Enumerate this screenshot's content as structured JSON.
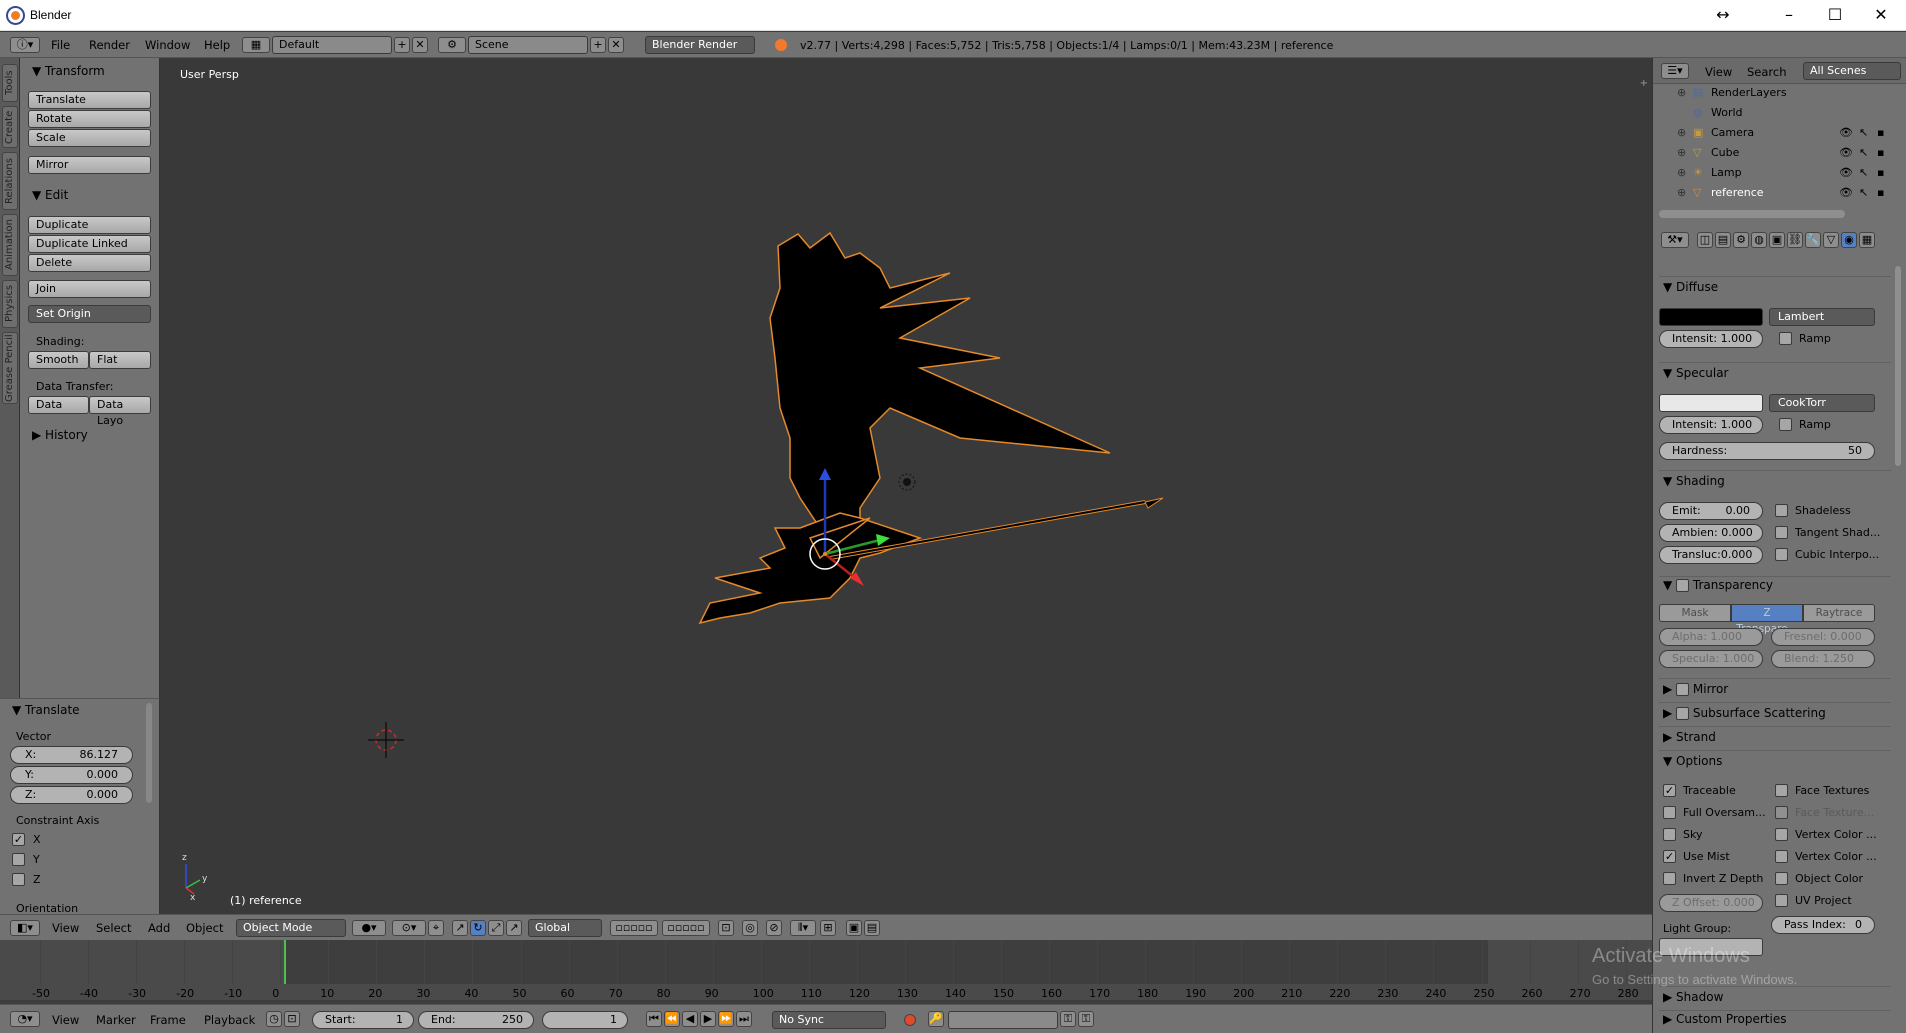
{
  "window": {
    "title": "Blender"
  },
  "menu": {
    "file": "File",
    "render": "Render",
    "window": "Window",
    "help": "Help"
  },
  "screen_layout": "Default",
  "scene": "Scene",
  "engine": "Blender Render",
  "stats": "v2.77 | Verts:4,298 | Faces:5,752 | Tris:5,758 | Objects:1/4 | Lamps:0/1 | Mem:43.23M | reference",
  "tool_tabs": [
    "Tools",
    "Create",
    "Relations",
    "Animation",
    "Physics",
    "Grease Pencil"
  ],
  "toolshelf": {
    "transform_header": "Transform",
    "translate": "Translate",
    "rotate": "Rotate",
    "scale": "Scale",
    "mirror": "Mirror",
    "edit_header": "Edit",
    "duplicate": "Duplicate",
    "duplicate_linked": "Duplicate Linked",
    "delete": "Delete",
    "join": "Join",
    "set_origin": "Set Origin",
    "shading_label": "Shading:",
    "smooth": "Smooth",
    "flat": "Flat",
    "data_transfer_label": "Data Transfer:",
    "data": "Data",
    "data_layout": "Data Layo",
    "history_header": "History"
  },
  "redo": {
    "header": "Translate",
    "vector_label": "Vector",
    "x_label": "X:",
    "x_value": "86.127",
    "y_label": "Y:",
    "y_value": "0.000",
    "z_label": "Z:",
    "z_value": "0.000",
    "constraint_label": "Constraint Axis",
    "cx": "X",
    "cy": "Y",
    "cz": "Z",
    "cx_checked": true,
    "cy_checked": false,
    "cz_checked": false,
    "orientation_label": "Orientation"
  },
  "viewport": {
    "view_name": "User Persp",
    "object_label": "(1) reference"
  },
  "view3d_header": {
    "view": "View",
    "select": "Select",
    "add": "Add",
    "object": "Object",
    "mode": "Object Mode",
    "orientation": "Global"
  },
  "timeline": {
    "ticks": [
      "-50",
      "-40",
      "-30",
      "-20",
      "-10",
      "0",
      "10",
      "20",
      "30",
      "40",
      "50",
      "60",
      "70",
      "80",
      "90",
      "100",
      "110",
      "120",
      "130",
      "140",
      "150",
      "160",
      "170",
      "180",
      "190",
      "200",
      "210",
      "220",
      "230",
      "240",
      "250",
      "260",
      "270",
      "280"
    ],
    "current_frame": 1
  },
  "timeline_header": {
    "view": "View",
    "marker": "Marker",
    "frame": "Frame",
    "playback": "Playback",
    "start_label": "Start:",
    "start_value": "1",
    "end_label": "End:",
    "end_value": "250",
    "current": "1",
    "sync": "No Sync"
  },
  "outliner": {
    "view": "View",
    "search": "Search",
    "filter": "All Scenes",
    "items": [
      "RenderLayers",
      "World",
      "Camera",
      "Cube",
      "Lamp",
      "reference"
    ]
  },
  "properties": {
    "diffuse_header": "Diffuse",
    "diffuse_shader": "Lambert",
    "diffuse_intensity": "Intensit: 1.000",
    "ramp": "Ramp",
    "specular_header": "Specular",
    "specular_shader": "CookTorr",
    "specular_intensity": "Intensit: 1.000",
    "hardness_label": "Hardness:",
    "hardness_value": "50",
    "shading_header": "Shading",
    "emit": "Emit:",
    "emit_value": "0.00",
    "ambient": "Ambien: 0.000",
    "translucency": "Transluc:0.000",
    "shadeless": "Shadeless",
    "tangent_shading": "Tangent Shad...",
    "cubic_interp": "Cubic Interpo...",
    "transparency_header": "Transparency",
    "mask": "Mask",
    "ztransp": "Z Transpare...",
    "raytrace": "Raytrace",
    "alpha": "Alpha:   1.000",
    "fresnel": "Fresnel: 0.000",
    "specular_t": "Specula: 1.000",
    "blend": "Blend:   1.250",
    "mirror_header": "Mirror",
    "sss_header": "Subsurface Scattering",
    "strand_header": "Strand",
    "options_header": "Options",
    "traceable": "Traceable",
    "full_oversampling": "Full Oversam...",
    "sky": "Sky",
    "use_mist": "Use Mist",
    "invert_z": "Invert Z Depth",
    "z_offset": "Z Offset: 0.000",
    "face_textures": "Face Textures",
    "face_textures_alpha": "Face Texture...",
    "vertex_color_1": "Vertex Color ...",
    "vertex_color_2": "Vertex Color ...",
    "object_color": "Object Color",
    "uv_project": "UV Project",
    "light_group": "Light Group:",
    "pass_index_label": "Pass Index:",
    "pass_index_value": "0",
    "shadow_header": "Shadow",
    "custom_props_header": "Custom Properties"
  },
  "watermark": {
    "line1": "Activate Windows",
    "line2": "Go to Settings to activate Windows."
  }
}
